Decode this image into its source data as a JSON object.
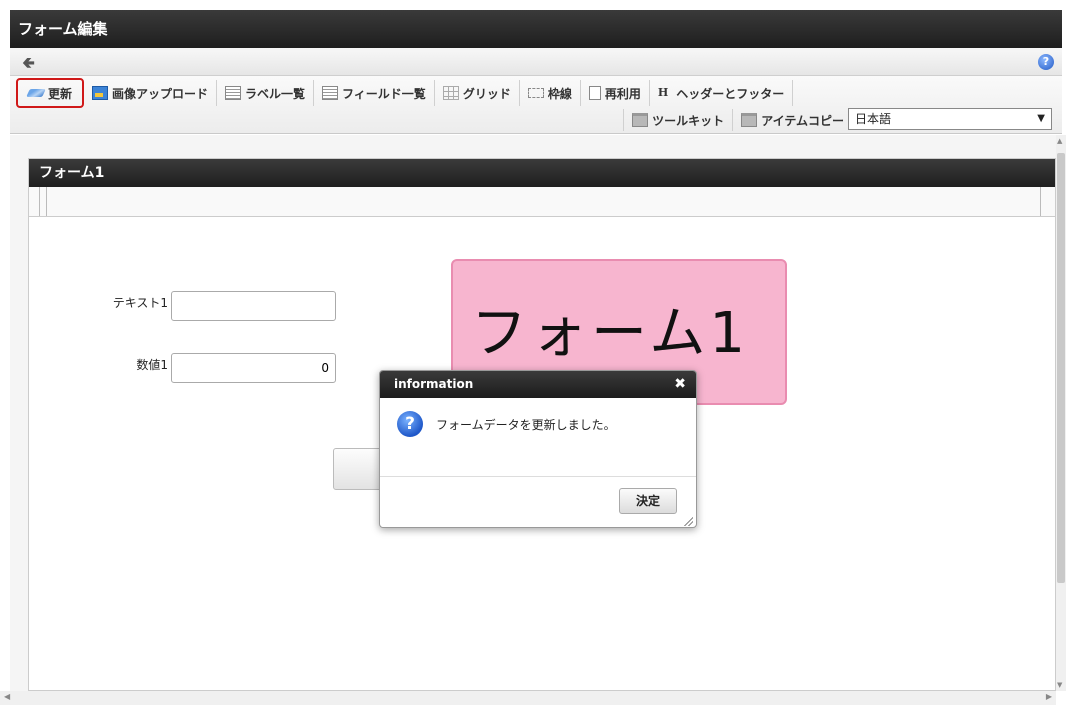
{
  "window": {
    "title": "フォーム編集"
  },
  "nav": {
    "back_icon": "arrow-left-icon",
    "help_icon": "help-icon"
  },
  "toolbar": {
    "row1": [
      {
        "id": "update",
        "label": "更新",
        "icon": "update-icon",
        "highlighted": true
      },
      {
        "id": "image-upload",
        "label": "画像アップロード",
        "icon": "image-upload-icon"
      },
      {
        "id": "label-list",
        "label": "ラベル一覧",
        "icon": "list-icon"
      },
      {
        "id": "field-list",
        "label": "フィールド一覧",
        "icon": "list-icon"
      },
      {
        "id": "grid",
        "label": "グリッド",
        "icon": "grid-icon"
      },
      {
        "id": "frame",
        "label": "枠線",
        "icon": "frame-icon"
      },
      {
        "id": "reuse",
        "label": "再利用",
        "icon": "document-icon"
      },
      {
        "id": "header-footer",
        "label": "ヘッダーとフッター",
        "icon": "header-icon",
        "icon_glyph": "H"
      }
    ],
    "row2": [
      {
        "id": "toolkit",
        "label": "ツールキット",
        "icon": "toolkit-icon"
      },
      {
        "id": "item-copy",
        "label": "アイテムコピー",
        "icon": "toolkit-icon"
      }
    ],
    "language": {
      "selected": "日本語"
    }
  },
  "form": {
    "title": "フォーム1",
    "fields": [
      {
        "label": "テキスト1",
        "value": ""
      },
      {
        "label": "数値1",
        "value": "0"
      }
    ],
    "big_label_text": "フォーム1"
  },
  "dialog": {
    "title": "information",
    "message": "フォームデータを更新しました。",
    "ok_label": "決定"
  },
  "colors": {
    "highlight_border": "#d01919",
    "label_bg": "#f7b5cf",
    "titlebar_bg": "#2a2a2a"
  }
}
